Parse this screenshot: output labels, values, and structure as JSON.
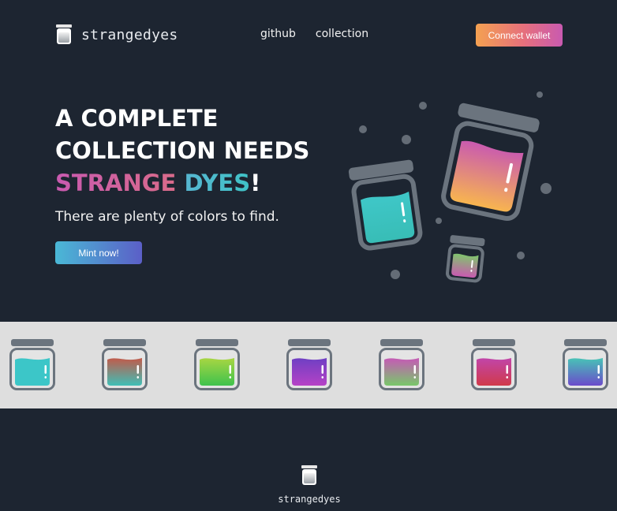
{
  "brand": {
    "name": "strangedyes",
    "icon": "jar-icon"
  },
  "nav": {
    "items": [
      {
        "label": "github"
      },
      {
        "label": "collection"
      }
    ]
  },
  "header": {
    "connect_label": "Connect wallet"
  },
  "hero": {
    "headline_line1": "A COMPLETE",
    "headline_line2": "COLLECTION NEEDS",
    "headline_strange": "STRANGE",
    "headline_dyes": "DYES",
    "headline_bang": "!",
    "tagline": "There are plenty of colors to find.",
    "mint_label": "Mint now!"
  },
  "colors": {
    "background": "#1d2531",
    "strip_background": "#dedede",
    "jar_outline": "#6b747e",
    "accent_pink": "#c95ab0",
    "accent_cyan": "#3fc3c7",
    "accent_orange": "#f4a151"
  },
  "jar_strip": [
    {
      "top": "#3cc6c8",
      "bottom": "#3cc6c8"
    },
    {
      "top": "#c25a4a",
      "bottom": "#3fbfb7"
    },
    {
      "top": "#a9d642",
      "bottom": "#3ec24d"
    },
    {
      "top": "#6e3fc3",
      "bottom": "#b642c6"
    },
    {
      "top": "#c659b6",
      "bottom": "#78c86a"
    },
    {
      "top": "#c145aa",
      "bottom": "#d03a4a"
    },
    {
      "top": "#48c4b6",
      "bottom": "#6a4bcb"
    }
  ],
  "footer": {
    "name": "strangedyes",
    "icon": "jar-icon"
  }
}
